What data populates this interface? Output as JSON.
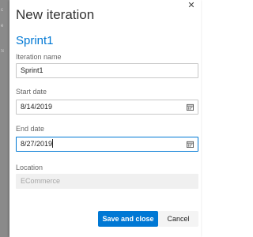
{
  "background": {
    "fragments": [
      "c",
      "e",
      "S"
    ]
  },
  "dialog": {
    "title": "New iteration",
    "heading": "Sprint1",
    "fields": {
      "iteration_name": {
        "label": "Iteration name",
        "value": "Sprint1"
      },
      "start_date": {
        "label": "Start date",
        "value": "8/14/2019"
      },
      "end_date": {
        "label": "End date",
        "value": "8/27/2019"
      },
      "location": {
        "label": "Location",
        "value": "ECommerce"
      }
    },
    "buttons": {
      "save": "Save and close",
      "cancel": "Cancel"
    },
    "colors": {
      "accent": "#0078d4",
      "disabled_bg": "#f0f0f0"
    },
    "icons": {
      "close": "close-icon",
      "calendar": "calendar-icon"
    }
  }
}
